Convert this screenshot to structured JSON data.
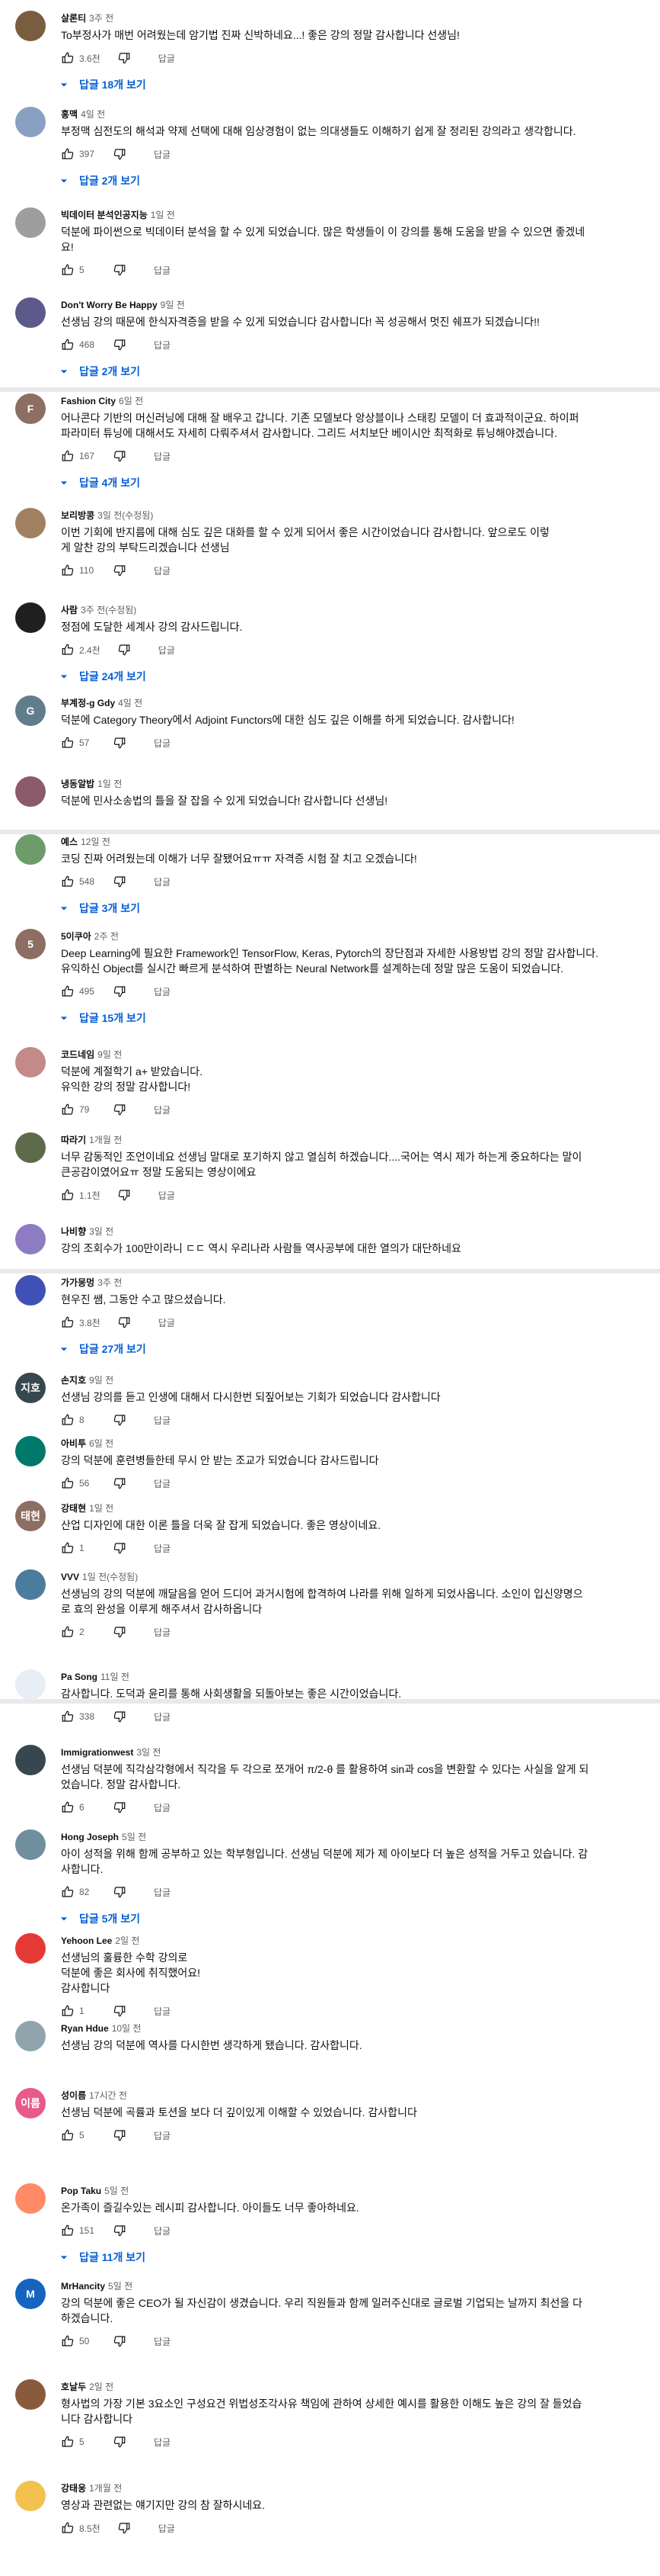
{
  "comments": [
    {
      "author": "살론티",
      "time": "3주 전",
      "lines": [
        "To부정사가 매번 어려웠는데 암기법 진짜 신박하네요...! 좋은 강의 정말 감사합니다 선생님!"
      ],
      "likes": "3.6천",
      "reply_label": "답글",
      "replies": "답글 18개 보기",
      "avatar_color": "#7a5c3e",
      "avatar_letter": ""
    },
    {
      "author": "홍맥",
      "time": "4일 전",
      "lines": [
        "부정맥 심전도의 해석과 약제 선택에 대해 임상경험이 없는 의대생들도 이해하기 쉽게 잘 정리된 강의라고 생각합니다."
      ],
      "likes": "397",
      "reply_label": "답글",
      "replies": "답글 2개 보기",
      "avatar_color": "#8aa0c2",
      "avatar_letter": ""
    },
    {
      "author": "빅데이터 분석인공지능",
      "time": "1일 전",
      "lines": [
        "덕분에 파이썬으로 빅데이터 분석을 할 수 있게 되었습니다. 많은 학생들이 이 강의를 통해 도움을 받을 수 있으면 좋겠네",
        "요!"
      ],
      "likes": "5",
      "reply_label": "답글",
      "replies": "",
      "avatar_color": "#9e9e9e",
      "avatar_letter": ""
    },
    {
      "author": "Don't Worry Be Happy",
      "time": "9일 전",
      "lines": [
        "선생님 강의 때문에 한식자격증을 받을 수 있게 되었습니다 감사합니다! 꼭 성공해서 멋진 쉐프가 되겠습니다!!"
      ],
      "likes": "468",
      "reply_label": "답글",
      "replies": "답글 2개 보기",
      "avatar_color": "#5c5a8a",
      "avatar_letter": ""
    },
    {
      "author": "Fashion City",
      "time": "6일 전",
      "lines": [
        "어나콘다 기반의 머신러닝에 대해 잘 배우고 갑니다. 기존 모델보다 앙상블이나 스태킹 모델이 더 효과적이군요. 하이퍼",
        "파라미터 튜닝에 대해서도 자세히 다뤄주셔서 감사합니다. 그리드 서치보단 베이시안 최적화로 튜닝해야겠습니다."
      ],
      "likes": "167",
      "reply_label": "답글",
      "replies": "답글 4개 보기",
      "avatar_color": "#8d6e63",
      "avatar_letter": "F"
    },
    {
      "author": "보리방콩",
      "time": "3일 전(수정됨)",
      "lines": [
        "이번 기회에 반지름에 대해 심도 깊은 대화를 할 수 있게 되어서 좋은 시간이었습니다 감사합니다. 앞으로도 이렇",
        "게 알찬 강의 부탁드리겠습니다 선생님"
      ],
      "likes": "110",
      "reply_label": "답글",
      "replies": "",
      "avatar_color": "#a08060",
      "avatar_letter": ""
    },
    {
      "author": "사람",
      "time": "3주 전(수정됨)",
      "lines": [
        "정점에 도달한 세계사 강의 감사드립니다."
      ],
      "likes": "2.4천",
      "reply_label": "답글",
      "replies": "답글 24개 보기",
      "avatar_color": "#1f1f1f",
      "avatar_letter": ""
    },
    {
      "author": "부계정-g Gdy",
      "time": "4일 전",
      "lines": [
        "덕분에 Category Theory에서 Adjoint Functors에 대한 심도 깊은 이해를 하게 되었습니다. 감사합니다!"
      ],
      "likes": "57",
      "reply_label": "답글",
      "replies": "",
      "avatar_color": "#607d8b",
      "avatar_letter": "G"
    },
    {
      "author": "냉동알밥",
      "time": "1일 전",
      "lines": [
        "덕분에 민사소송법의 틀을 잘 잡을 수 있게 되었습니다! 감사합니다 선생님!"
      ],
      "likes": "",
      "reply_label": "",
      "replies": "",
      "avatar_color": "#8b5a6b",
      "avatar_letter": ""
    },
    {
      "author": "예스",
      "time": "12일 전",
      "lines": [
        "코딩 진짜 어려웠는데 이해가 너무 잘됐어요ㅠㅠ 자격증 시험 잘 치고 오겠습니다!"
      ],
      "likes": "548",
      "reply_label": "답글",
      "replies": "답글 3개 보기",
      "avatar_color": "#6d9c6a",
      "avatar_letter": ""
    },
    {
      "author": "5이쿠아",
      "time": "2주 전",
      "lines": [
        "Deep Learning에 필요한 Framework인 TensorFlow, Keras, Pytorch의 장단점과 자세한 사용방법 강의 정말 감사합니다.",
        "유익하신 Object를 실시간 빠르게 분석하여 판별하는 Neural Network를 설계하는데 정말 많은 도움이 되었습니다."
      ],
      "likes": "495",
      "reply_label": "답글",
      "replies": "답글 15개 보기",
      "avatar_color": "#8d6e63",
      "avatar_letter": "5"
    },
    {
      "author": "코드네임",
      "time": "9일 전",
      "lines": [
        "덕분에 계절학기 a+ 받았습니다.",
        "유익한 강의 정말 감사합니다!"
      ],
      "likes": "79",
      "reply_label": "답글",
      "replies": "",
      "avatar_color": "#c48a8a",
      "avatar_letter": ""
    },
    {
      "author": "따라기",
      "time": "1개월 전",
      "lines": [
        "너무 감동적인 조언이네요 선생님 말대로 포기하지 않고 열심히 하겠습니다....국어는 역시 제가 하는게 중요하다는 말이",
        "큰공감이였어요ㅠ 정말 도움되는 영상이에요"
      ],
      "likes": "1.1천",
      "reply_label": "답글",
      "replies": "",
      "avatar_color": "#5d6b4a",
      "avatar_letter": ""
    },
    {
      "author": "나비향",
      "time": "3일 전",
      "lines": [
        "강의 조회수가 100만이라니 ㄷㄷ 역시 우리나라 사람들 역사공부에 대한 열의가 대단하네요"
      ],
      "likes": "",
      "reply_label": "",
      "replies": "",
      "avatar_color": "#8e7cc3",
      "avatar_letter": ""
    },
    {
      "author": "가가몽멍",
      "time": "3주 전",
      "lines": [
        "현우진 쌤, 그동안 수고 많으셨습니다."
      ],
      "likes": "3.8천",
      "reply_label": "답글",
      "replies": "답글 27개 보기",
      "avatar_color": "#3f51b5",
      "avatar_letter": ""
    },
    {
      "author": "손지호",
      "time": "9일 전",
      "lines": [
        "선생님 강의를 듣고 인생에 대해서 다시한번 되짚어보는 기회가 되었습니다 감사합니다"
      ],
      "likes": "8",
      "reply_label": "답글",
      "replies": "",
      "avatar_color": "#37474f",
      "avatar_letter": "지호"
    },
    {
      "author": "아비투",
      "time": "6일 전",
      "lines": [
        "강의 덕분에 훈련병들한테 무시 안 받는 조교가 되었습니다 감사드립니다"
      ],
      "likes": "56",
      "reply_label": "답글",
      "replies": "",
      "avatar_color": "#00796b",
      "avatar_letter": ""
    },
    {
      "author": "강태현",
      "time": "1일 전",
      "lines": [
        "산업 디자인에 대한 이론 틀을 더욱 잘 잡게 되었습니다. 좋은 영상이네요."
      ],
      "likes": "1",
      "reply_label": "답글",
      "replies": "",
      "avatar_color": "#8d6e63",
      "avatar_letter": "태현"
    },
    {
      "author": "VVV",
      "time": "1일 전(수정됨)",
      "lines": [
        "선생님의 강의 덕분에 깨달음을 얻어 드디어 과거시험에 합격하여 나라를 위해 일하게 되었사옵니다.  소인이 입신양명으",
        "로 효의 완성을 이루게 해주셔서 감사하옵니다"
      ],
      "likes": "2",
      "reply_label": "답글",
      "replies": "",
      "avatar_color": "#4a7c9e",
      "avatar_letter": ""
    },
    {
      "author": "Pa Song",
      "time": "11일 전",
      "lines": [
        "감사합니다. 도덕과 윤리를 통해 사회생활을 되돌아보는 좋은 시간이었습니다."
      ],
      "likes": "338",
      "reply_label": "답글",
      "replies": "",
      "avatar_color": "#e8eef5",
      "avatar_letter": ""
    },
    {
      "author": "Immigrationwest",
      "time": "3일 전",
      "lines": [
        "선생님 덕분에 직각삼각형에서 직각을 두 각으로 쪼개어 π/2-θ 를 활용하여 sin과 cos을 변환할 수 있다는 사실을 알게 되",
        "었습니다. 정말 감사합니다."
      ],
      "likes": "6",
      "reply_label": "답글",
      "replies": "",
      "avatar_color": "#37474f",
      "avatar_letter": ""
    },
    {
      "author": "Hong Joseph",
      "time": "5일 전",
      "lines": [
        "아이 성적을 위해 함께 공부하고 있는 학부형입니다. 선생님 덕분에 제가 제 아이보다 더 높은 성적을 거두고 있습니다. 감",
        "사합니다."
      ],
      "likes": "82",
      "reply_label": "답글",
      "replies": "답글 5개 보기",
      "avatar_color": "#6f8f9e",
      "avatar_letter": ""
    },
    {
      "author": "Yehoon Lee",
      "time": "2일 전",
      "lines": [
        "선생님의 훌륭한 수학 강의로",
        "덕분에 좋은 회사에 취직했어요!",
        "감사합니다"
      ],
      "likes": "1",
      "reply_label": "답글",
      "replies": "",
      "avatar_color": "#e53935",
      "avatar_letter": ""
    },
    {
      "author": "Ryan Hdue",
      "time": "10일 전",
      "lines": [
        "선생님 강의 덕분에 역사를 다시한번 생각하게 됐습니다. 감사합니다."
      ],
      "likes": "",
      "reply_label": "",
      "replies": "",
      "avatar_color": "#90a4ae",
      "avatar_letter": ""
    },
    {
      "author": "성이름",
      "time": "17시간 전",
      "lines": [
        "선생님 덕분에 곡률과 토션을 보다 더 깊이있게 이해할 수 있었습니다. 감사합니다"
      ],
      "likes": "5",
      "reply_label": "답글",
      "replies": "",
      "avatar_color": "#e85a8c",
      "avatar_letter": "이름"
    },
    {
      "author": "Pop Taku",
      "time": "5일 전",
      "lines": [
        "온가족이 즐길수있는 레시피 감사합니다. 아이들도 너무 좋아하네요."
      ],
      "likes": "151",
      "reply_label": "답글",
      "replies": "답글 11개 보기",
      "avatar_color": "#ff8a65",
      "avatar_letter": ""
    },
    {
      "author": "MrHancity",
      "time": "5일 전",
      "lines": [
        "강의 덕분에 좋은 CEO가 될 자신감이 생겼습니다. 우리 직원들과 함께 일러주신대로 글로벌 기업되는 날까지 최선을 다",
        "하겠습니다."
      ],
      "likes": "50",
      "reply_label": "답글",
      "replies": "",
      "avatar_color": "#1565c0",
      "avatar_letter": "M"
    },
    {
      "author": "호날두",
      "time": "2일 전",
      "lines": [
        "형사법의 가장 기본 3요소인 구성요건 위법성조각사유 책임에 관하여 상세한 예시를 활용한 이해도 높은 강의 잘 들었습",
        "니다 감사합니다"
      ],
      "likes": "5",
      "reply_label": "답글",
      "replies": "",
      "avatar_color": "#8a5a3c",
      "avatar_letter": ""
    },
    {
      "author": "강태웅",
      "time": "1개월 전",
      "lines": [
        "영상과 관련없는 얘기지만 강의 참 잘하시네요."
      ],
      "likes": "8.5천",
      "reply_label": "답글",
      "replies": "",
      "avatar_color": "#f2c14e",
      "avatar_letter": ""
    }
  ]
}
